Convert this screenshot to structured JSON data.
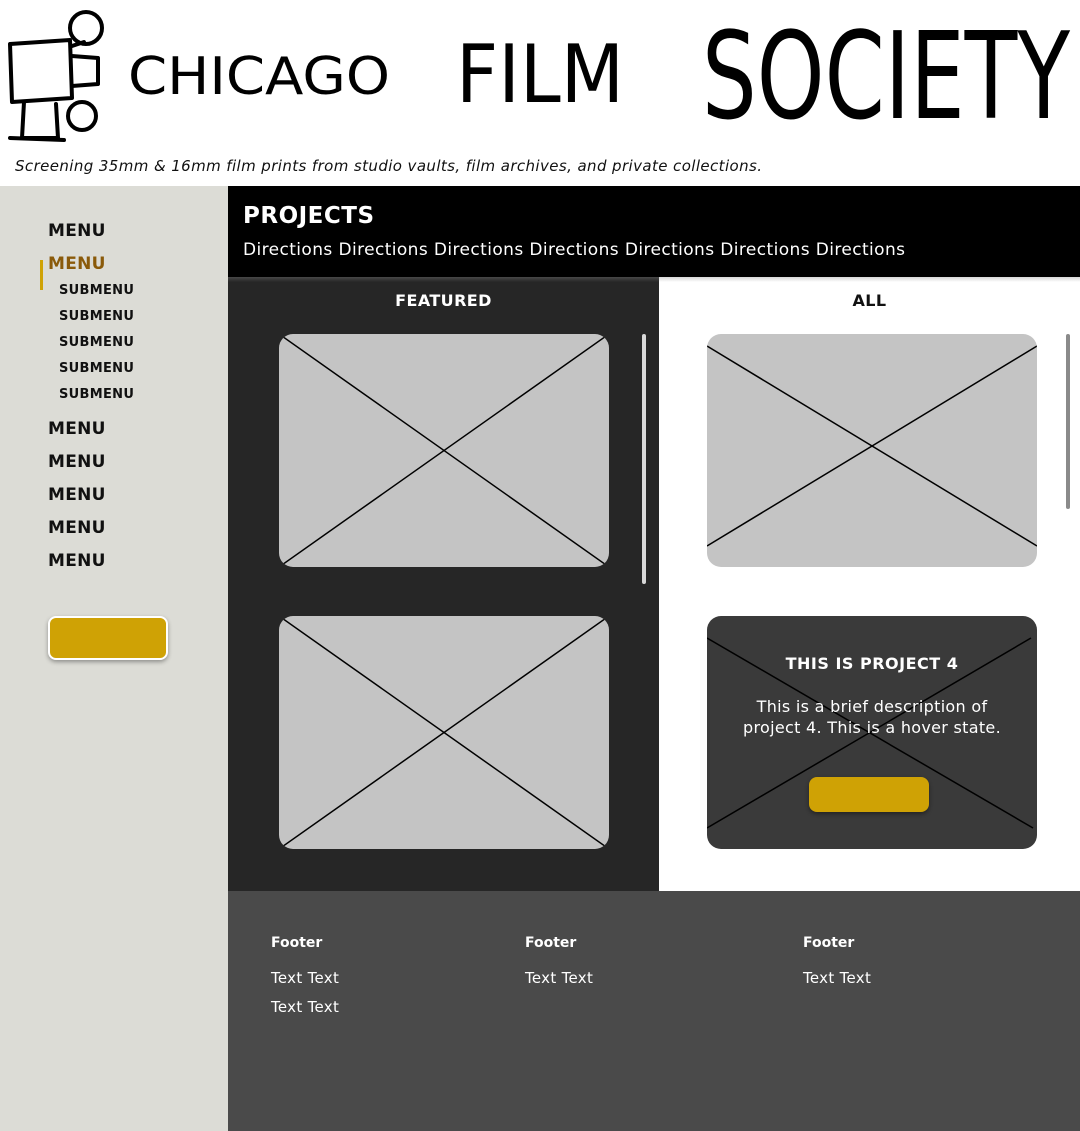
{
  "header": {
    "logo_text": "CHICAGO FILM SOCIETY",
    "logo_words": [
      "CHICAGO",
      "FILM",
      "SOCIETY"
    ],
    "tagline": "Screening 35mm & 16mm film prints from studio vaults, film archives, and private collections."
  },
  "sidebar": {
    "items": [
      {
        "label": "MENU",
        "active": false
      },
      {
        "label": "MENU",
        "active": true,
        "submenu": [
          "SUBMENU",
          "SUBMENU",
          "SUBMENU",
          "SUBMENU",
          "SUBMENU"
        ]
      },
      {
        "label": "MENU",
        "active": false
      },
      {
        "label": "MENU",
        "active": false
      },
      {
        "label": "MENU",
        "active": false
      },
      {
        "label": "MENU",
        "active": false
      },
      {
        "label": "MENU",
        "active": false
      }
    ],
    "button_label": ""
  },
  "projects": {
    "title": "PROJECTS",
    "directions": "Directions Directions Directions Directions Directions Directions Directions"
  },
  "featured": {
    "title": "FEATURED"
  },
  "all": {
    "title": "ALL",
    "hover_card": {
      "title": "THIS IS PROJECT 4",
      "description": "This is a brief description of project 4. This is a hover state.",
      "button_label": ""
    }
  },
  "footer": {
    "columns": [
      {
        "heading": "Footer",
        "links": [
          "Text Text",
          "Text Text"
        ]
      },
      {
        "heading": "Footer",
        "links": [
          "Text Text"
        ]
      },
      {
        "heading": "Footer",
        "links": [
          "Text Text"
        ]
      }
    ]
  },
  "colors": {
    "accent": "#cfa205",
    "active_menu": "#8a5a0a",
    "sidebar_bg": "#dcdcd6",
    "featured_bg": "#262626",
    "footer_bg": "#4a4a4a",
    "placeholder": "#c4c4c4"
  }
}
